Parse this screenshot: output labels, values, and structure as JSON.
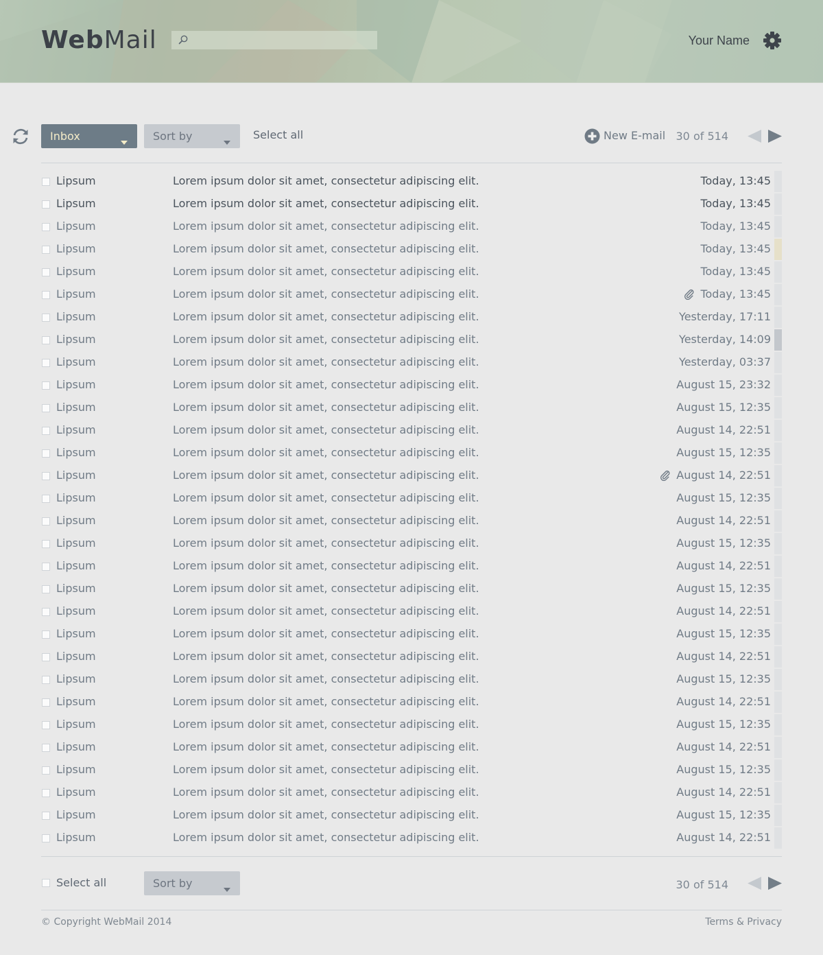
{
  "header": {
    "logo_bold": "Web",
    "logo_light": "Mail",
    "search_placeholder": "",
    "user_name": "Your Name",
    "search_icon": "search-icon",
    "settings_icon": "gear-icon"
  },
  "toolbar": {
    "refresh_icon": "refresh-icon",
    "folder_label": "Inbox",
    "sort_label": "Sort by",
    "select_all_label": "Select all",
    "new_email_label": "New E-mail",
    "pager_text": "30 of 514"
  },
  "colors": {
    "folder_button": "#6d7c87",
    "folder_text": "#f4ecc8",
    "sort_button": "#c6cacf",
    "background": "#e9e9e9"
  },
  "messages": [
    {
      "sender": "Lipsum",
      "subject": "Lorem ipsum dolor sit amet, consectetur adipiscing elit.",
      "date": "Today, 13:45",
      "unread": true,
      "attachment": false,
      "marker": "#dfe1e3"
    },
    {
      "sender": "Lipsum",
      "subject": "Lorem ipsum dolor sit amet, consectetur adipiscing elit.",
      "date": "Today, 13:45",
      "unread": true,
      "attachment": false,
      "marker": "#dfe1e3"
    },
    {
      "sender": "Lipsum",
      "subject": "Lorem ipsum dolor sit amet, consectetur adipiscing elit.",
      "date": "Today, 13:45",
      "unread": false,
      "attachment": false,
      "marker": "#dfe1e3"
    },
    {
      "sender": "Lipsum",
      "subject": "Lorem ipsum dolor sit amet, consectetur adipiscing elit.",
      "date": "Today, 13:45",
      "unread": false,
      "attachment": false,
      "marker": "#e6e0c9"
    },
    {
      "sender": "Lipsum",
      "subject": "Lorem ipsum dolor sit amet, consectetur adipiscing elit.",
      "date": "Today, 13:45",
      "unread": false,
      "attachment": false,
      "marker": "#dfe1e3"
    },
    {
      "sender": "Lipsum",
      "subject": "Lorem ipsum dolor sit amet, consectetur adipiscing elit.",
      "date": "Today, 13:45",
      "unread": false,
      "attachment": true,
      "marker": "#dfe1e3"
    },
    {
      "sender": "Lipsum",
      "subject": "Lorem ipsum dolor sit amet, consectetur adipiscing elit.",
      "date": "Yesterday, 17:11",
      "unread": false,
      "attachment": false,
      "marker": "#dfe1e3"
    },
    {
      "sender": "Lipsum",
      "subject": "Lorem ipsum dolor sit amet, consectetur adipiscing elit.",
      "date": "Yesterday, 14:09",
      "unread": false,
      "attachment": false,
      "marker": "#c3c7cc"
    },
    {
      "sender": "Lipsum",
      "subject": "Lorem ipsum dolor sit amet, consectetur adipiscing elit.",
      "date": "Yesterday, 03:37",
      "unread": false,
      "attachment": false,
      "marker": "#dfe1e3"
    },
    {
      "sender": "Lipsum",
      "subject": "Lorem ipsum dolor sit amet, consectetur adipiscing elit.",
      "date": "August 15, 23:32",
      "unread": false,
      "attachment": false,
      "marker": "#dfe1e3"
    },
    {
      "sender": "Lipsum",
      "subject": "Lorem ipsum dolor sit amet, consectetur adipiscing elit.",
      "date": "August 15, 12:35",
      "unread": false,
      "attachment": false,
      "marker": "#dfe1e3"
    },
    {
      "sender": "Lipsum",
      "subject": "Lorem ipsum dolor sit amet, consectetur adipiscing elit.",
      "date": "August 14, 22:51",
      "unread": false,
      "attachment": false,
      "marker": "#dfe1e3"
    },
    {
      "sender": "Lipsum",
      "subject": "Lorem ipsum dolor sit amet, consectetur adipiscing elit.",
      "date": "August 15, 12:35",
      "unread": false,
      "attachment": false,
      "marker": "#dfe1e3"
    },
    {
      "sender": "Lipsum",
      "subject": "Lorem ipsum dolor sit amet, consectetur adipiscing elit.",
      "date": "August 14, 22:51",
      "unread": false,
      "attachment": true,
      "marker": "#dfe1e3"
    },
    {
      "sender": "Lipsum",
      "subject": "Lorem ipsum dolor sit amet, consectetur adipiscing elit.",
      "date": "August 15, 12:35",
      "unread": false,
      "attachment": false,
      "marker": "#dfe1e3"
    },
    {
      "sender": "Lipsum",
      "subject": "Lorem ipsum dolor sit amet, consectetur adipiscing elit.",
      "date": "August 14, 22:51",
      "unread": false,
      "attachment": false,
      "marker": "#dfe1e3"
    },
    {
      "sender": "Lipsum",
      "subject": "Lorem ipsum dolor sit amet, consectetur adipiscing elit.",
      "date": "August 15, 12:35",
      "unread": false,
      "attachment": false,
      "marker": "#dfe1e3"
    },
    {
      "sender": "Lipsum",
      "subject": "Lorem ipsum dolor sit amet, consectetur adipiscing elit.",
      "date": "August 14, 22:51",
      "unread": false,
      "attachment": false,
      "marker": "#dfe1e3"
    },
    {
      "sender": "Lipsum",
      "subject": "Lorem ipsum dolor sit amet, consectetur adipiscing elit.",
      "date": "August 15, 12:35",
      "unread": false,
      "attachment": false,
      "marker": "#dfe1e3"
    },
    {
      "sender": "Lipsum",
      "subject": "Lorem ipsum dolor sit amet, consectetur adipiscing elit.",
      "date": "August 14, 22:51",
      "unread": false,
      "attachment": false,
      "marker": "#dfe1e3"
    },
    {
      "sender": "Lipsum",
      "subject": "Lorem ipsum dolor sit amet, consectetur adipiscing elit.",
      "date": "August 15, 12:35",
      "unread": false,
      "attachment": false,
      "marker": "#dfe1e3"
    },
    {
      "sender": "Lipsum",
      "subject": "Lorem ipsum dolor sit amet, consectetur adipiscing elit.",
      "date": "August 14, 22:51",
      "unread": false,
      "attachment": false,
      "marker": "#dfe1e3"
    },
    {
      "sender": "Lipsum",
      "subject": "Lorem ipsum dolor sit amet, consectetur adipiscing elit.",
      "date": "August 15, 12:35",
      "unread": false,
      "attachment": false,
      "marker": "#dfe1e3"
    },
    {
      "sender": "Lipsum",
      "subject": "Lorem ipsum dolor sit amet, consectetur adipiscing elit.",
      "date": "August 14, 22:51",
      "unread": false,
      "attachment": false,
      "marker": "#dfe1e3"
    },
    {
      "sender": "Lipsum",
      "subject": "Lorem ipsum dolor sit amet, consectetur adipiscing elit.",
      "date": "August 15, 12:35",
      "unread": false,
      "attachment": false,
      "marker": "#dfe1e3"
    },
    {
      "sender": "Lipsum",
      "subject": "Lorem ipsum dolor sit amet, consectetur adipiscing elit.",
      "date": "August 14, 22:51",
      "unread": false,
      "attachment": false,
      "marker": "#dfe1e3"
    },
    {
      "sender": "Lipsum",
      "subject": "Lorem ipsum dolor sit amet, consectetur adipiscing elit.",
      "date": "August 15, 12:35",
      "unread": false,
      "attachment": false,
      "marker": "#dfe1e3"
    },
    {
      "sender": "Lipsum",
      "subject": "Lorem ipsum dolor sit amet, consectetur adipiscing elit.",
      "date": "August 14, 22:51",
      "unread": false,
      "attachment": false,
      "marker": "#dfe1e3"
    },
    {
      "sender": "Lipsum",
      "subject": "Lorem ipsum dolor sit amet, consectetur adipiscing elit.",
      "date": "August 15, 12:35",
      "unread": false,
      "attachment": false,
      "marker": "#dfe1e3"
    },
    {
      "sender": "Lipsum",
      "subject": "Lorem ipsum dolor sit amet, consectetur adipiscing elit.",
      "date": "August 14, 22:51",
      "unread": false,
      "attachment": false,
      "marker": "#dfe1e3"
    }
  ],
  "footer": {
    "select_all_label": "Select all",
    "sort_label": "Sort by",
    "pager_text": "30 of 514",
    "copyright": "© Copyright WebMail 2014",
    "terms": "Terms & Privacy"
  }
}
